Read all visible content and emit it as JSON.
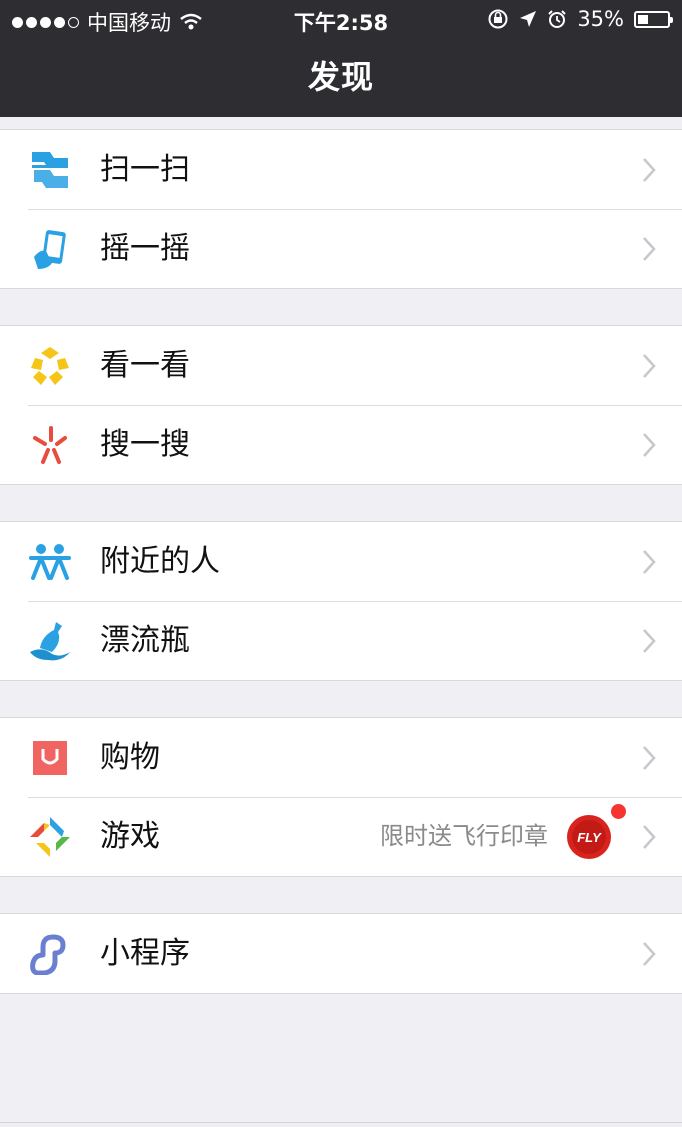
{
  "status_bar": {
    "carrier": "中国移动",
    "time": "下午2:58",
    "battery": "35%",
    "battery_level": 0.35
  },
  "nav": {
    "title": "发现"
  },
  "groups": [
    {
      "items": [
        {
          "label": "扫一扫",
          "icon": "scan-icon"
        },
        {
          "label": "摇一摇",
          "icon": "shake-icon"
        }
      ]
    },
    {
      "items": [
        {
          "label": "看一看",
          "icon": "top-stories-icon"
        },
        {
          "label": "搜一搜",
          "icon": "search-icon"
        }
      ]
    },
    {
      "items": [
        {
          "label": "附近的人",
          "icon": "people-nearby-icon"
        },
        {
          "label": "漂流瓶",
          "icon": "drift-bottle-icon"
        }
      ]
    },
    {
      "items": [
        {
          "label": "购物",
          "icon": "shopping-icon"
        },
        {
          "label": "游戏",
          "icon": "games-icon",
          "subtitle": "限时送飞行印章",
          "badge_icon": "fly-stamp-icon",
          "has_red_dot": true
        }
      ]
    },
    {
      "items": [
        {
          "label": "小程序",
          "icon": "mini-program-icon"
        }
      ]
    }
  ],
  "colors": {
    "nav_bg": "#2e2e32",
    "page_bg": "#efeff4",
    "scan_blue": "#2aa1e3",
    "top_stories_yellow": "#f5c518",
    "search_red": "#e84c3d",
    "shopping_red": "#f06461",
    "mini_program_blue": "#6b7fd1",
    "red_dot": "#f43530"
  }
}
